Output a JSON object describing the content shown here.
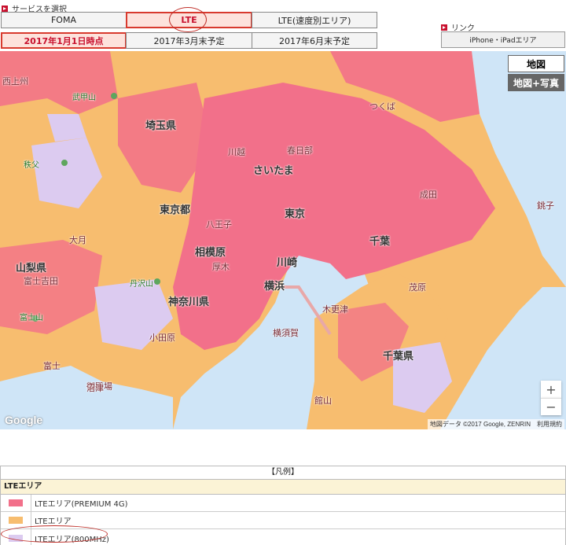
{
  "service": {
    "label": "サービスを選択",
    "tabs": [
      {
        "label": "FOMA",
        "active": false
      },
      {
        "label": "LTE",
        "active": true
      },
      {
        "label": "LTE(速度別エリア)",
        "active": false
      }
    ],
    "dates": [
      {
        "label": "2017年1月1日時点",
        "active": true
      },
      {
        "label": "2017年3月末予定",
        "active": false
      },
      {
        "label": "2017年6月末予定",
        "active": false
      }
    ]
  },
  "link": {
    "label": "リンク",
    "button": "iPhone・iPadエリア"
  },
  "map": {
    "type_map": "地図",
    "type_satellite": "地図+写真",
    "zoom_in": "+",
    "zoom_out": "−",
    "logo": "Google",
    "attribution": "地図データ ©2017 Google, ZENRIN　利用規約",
    "labels": {
      "saitama_pref": "埼玉県",
      "saitama": "さいたま",
      "tokyo": "東京",
      "tokyo_to": "東京都",
      "chiba": "千葉",
      "chiba_pref": "千葉県",
      "kawasaki": "川崎",
      "yokohama": "横浜",
      "sagamihara": "相模原",
      "kanagawa": "神奈川県",
      "yamanashi": "山梨県",
      "tsukuba": "つくば",
      "hachioji": "八王子",
      "fuji": "富士山",
      "fuji_city": "富士",
      "gotemba": "御殿場",
      "odawara": "小田原",
      "yokosuka": "横須賀",
      "kisarazu": "木更津",
      "narita": "成田",
      "kawagoe": "川越",
      "kasukabe": "春日部",
      "choshi": "銚子",
      "atsugi": "厚木",
      "chichibu": "秩父",
      "mobara": "茂原",
      "tanzawa": "丹沢山",
      "minobu": "富士吉田",
      "kamogawa": "館山",
      "mt_buko": "武甲山",
      "mt_myogi": "西上州",
      "otsuki": "大月",
      "numazu": "沼津"
    }
  },
  "legend": {
    "title": "【凡例】",
    "header": "LTEエリア",
    "items": [
      {
        "label": "LTEエリア(PREMIUM 4G)",
        "color": "#f2708a"
      },
      {
        "label": "LTEエリア",
        "color": "#f7bd6f"
      },
      {
        "label": "LTEエリア(800MHz)",
        "color": "#dccbf0"
      }
    ]
  },
  "colors": {
    "premium": "#f2708a",
    "lte": "#f7bd6f",
    "lte800": "#dccbf0",
    "sea": "#b8d8f2",
    "accent": "#c8102e"
  }
}
